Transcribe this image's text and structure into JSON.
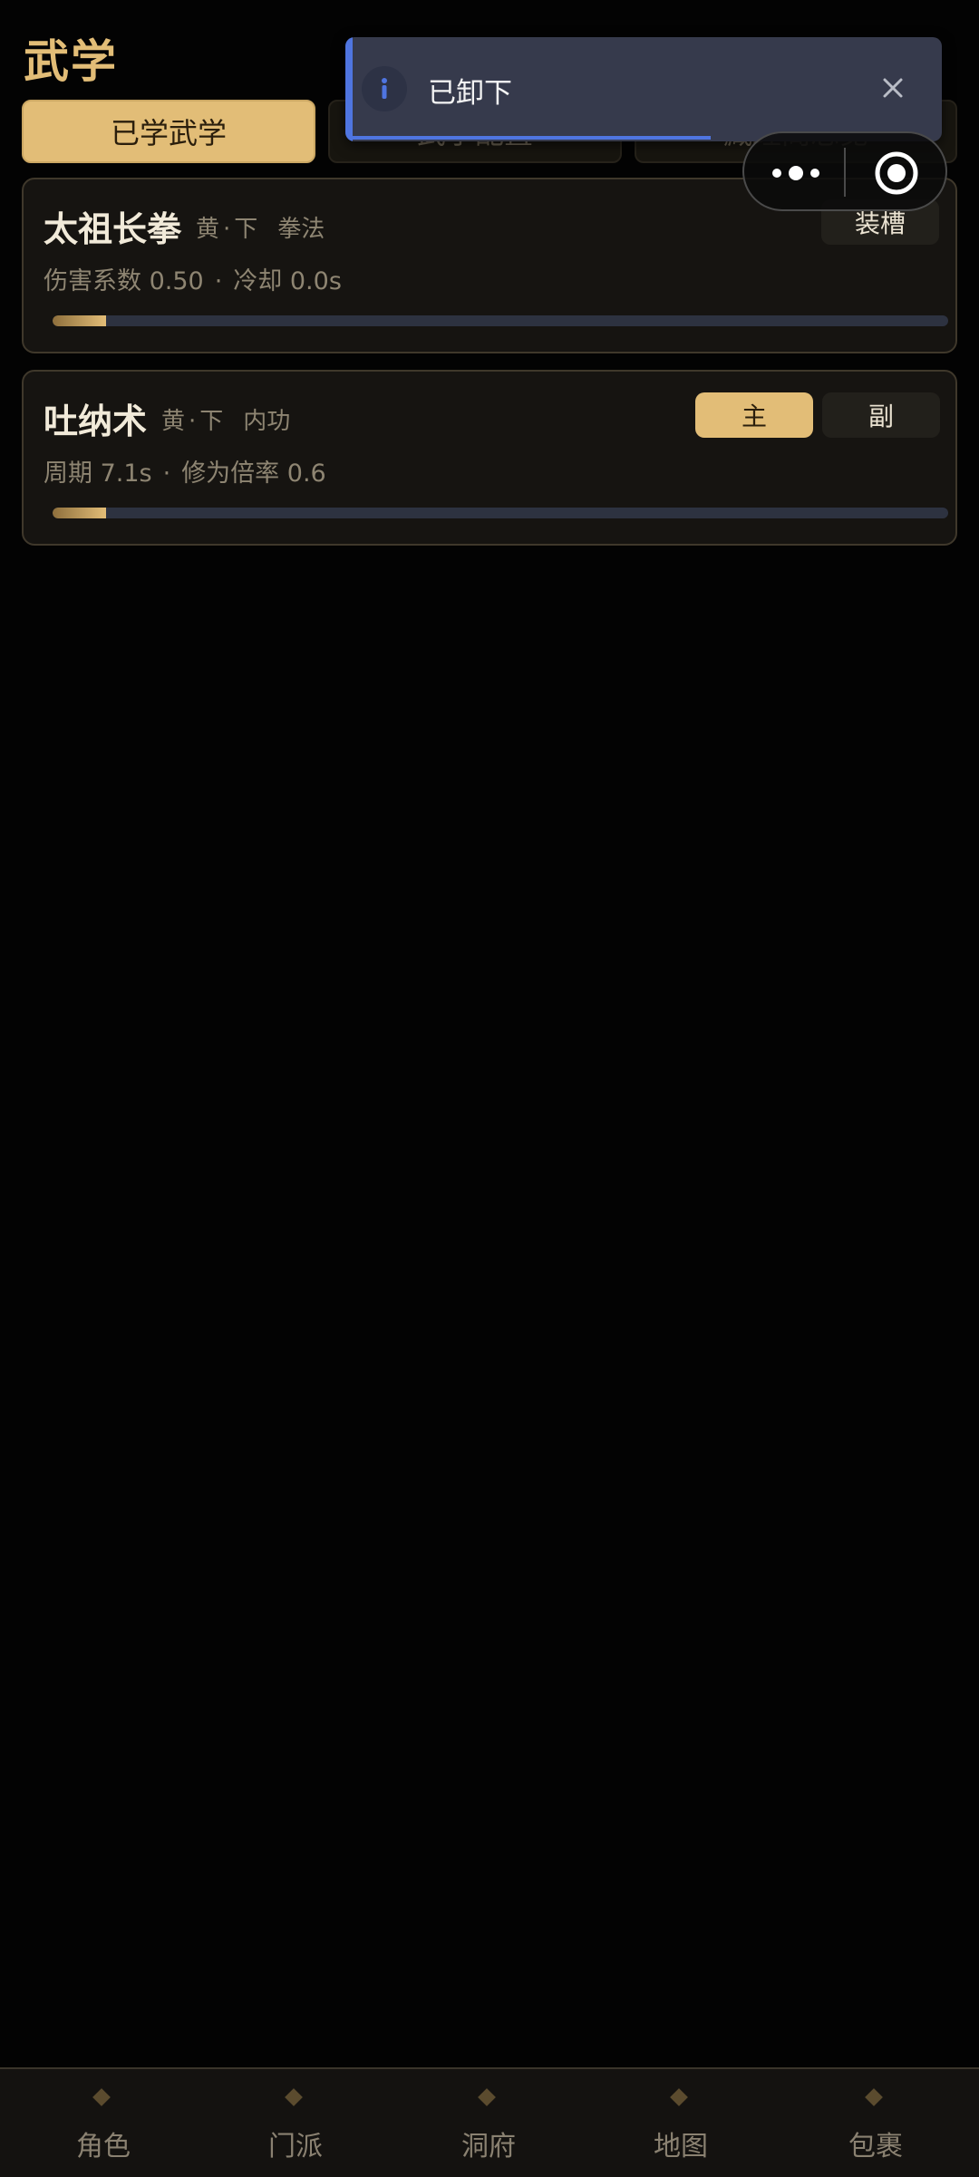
{
  "page": {
    "title": "武学"
  },
  "tabs": [
    {
      "label": "已学武学",
      "active": true
    },
    {
      "label": "武学配置",
      "active": false
    },
    {
      "label": "藏经阁总览",
      "active": false
    }
  ],
  "skills": [
    {
      "name": "太祖长拳",
      "grade": "黄",
      "tier": "下",
      "type": "拳法",
      "stat1": "伤害系数 0.50",
      "stat2": "冷却 0.0s",
      "progress": 0.06,
      "buttons": [
        "装槽"
      ]
    },
    {
      "name": "吐纳术",
      "grade": "黄",
      "tier": "下",
      "type": "内功",
      "stat1": "周期 7.1s",
      "stat2": "修为倍率 0.6",
      "progress": 0.06,
      "buttons": [
        "主",
        "副"
      ]
    }
  ],
  "toast": {
    "message": "已卸下",
    "icon": "info-icon",
    "accent_color": "#4f75e0",
    "remaining": 0.6
  },
  "capsule": {
    "menu_icon": "more-dots-icon",
    "close_icon": "target-circle-icon"
  },
  "bottom_nav": [
    {
      "label": "角色"
    },
    {
      "label": "门派"
    },
    {
      "label": "洞府"
    },
    {
      "label": "地图"
    },
    {
      "label": "包裹"
    }
  ],
  "colors": {
    "gold": "#e2bd77",
    "background": "#030303",
    "card": "#161411"
  }
}
